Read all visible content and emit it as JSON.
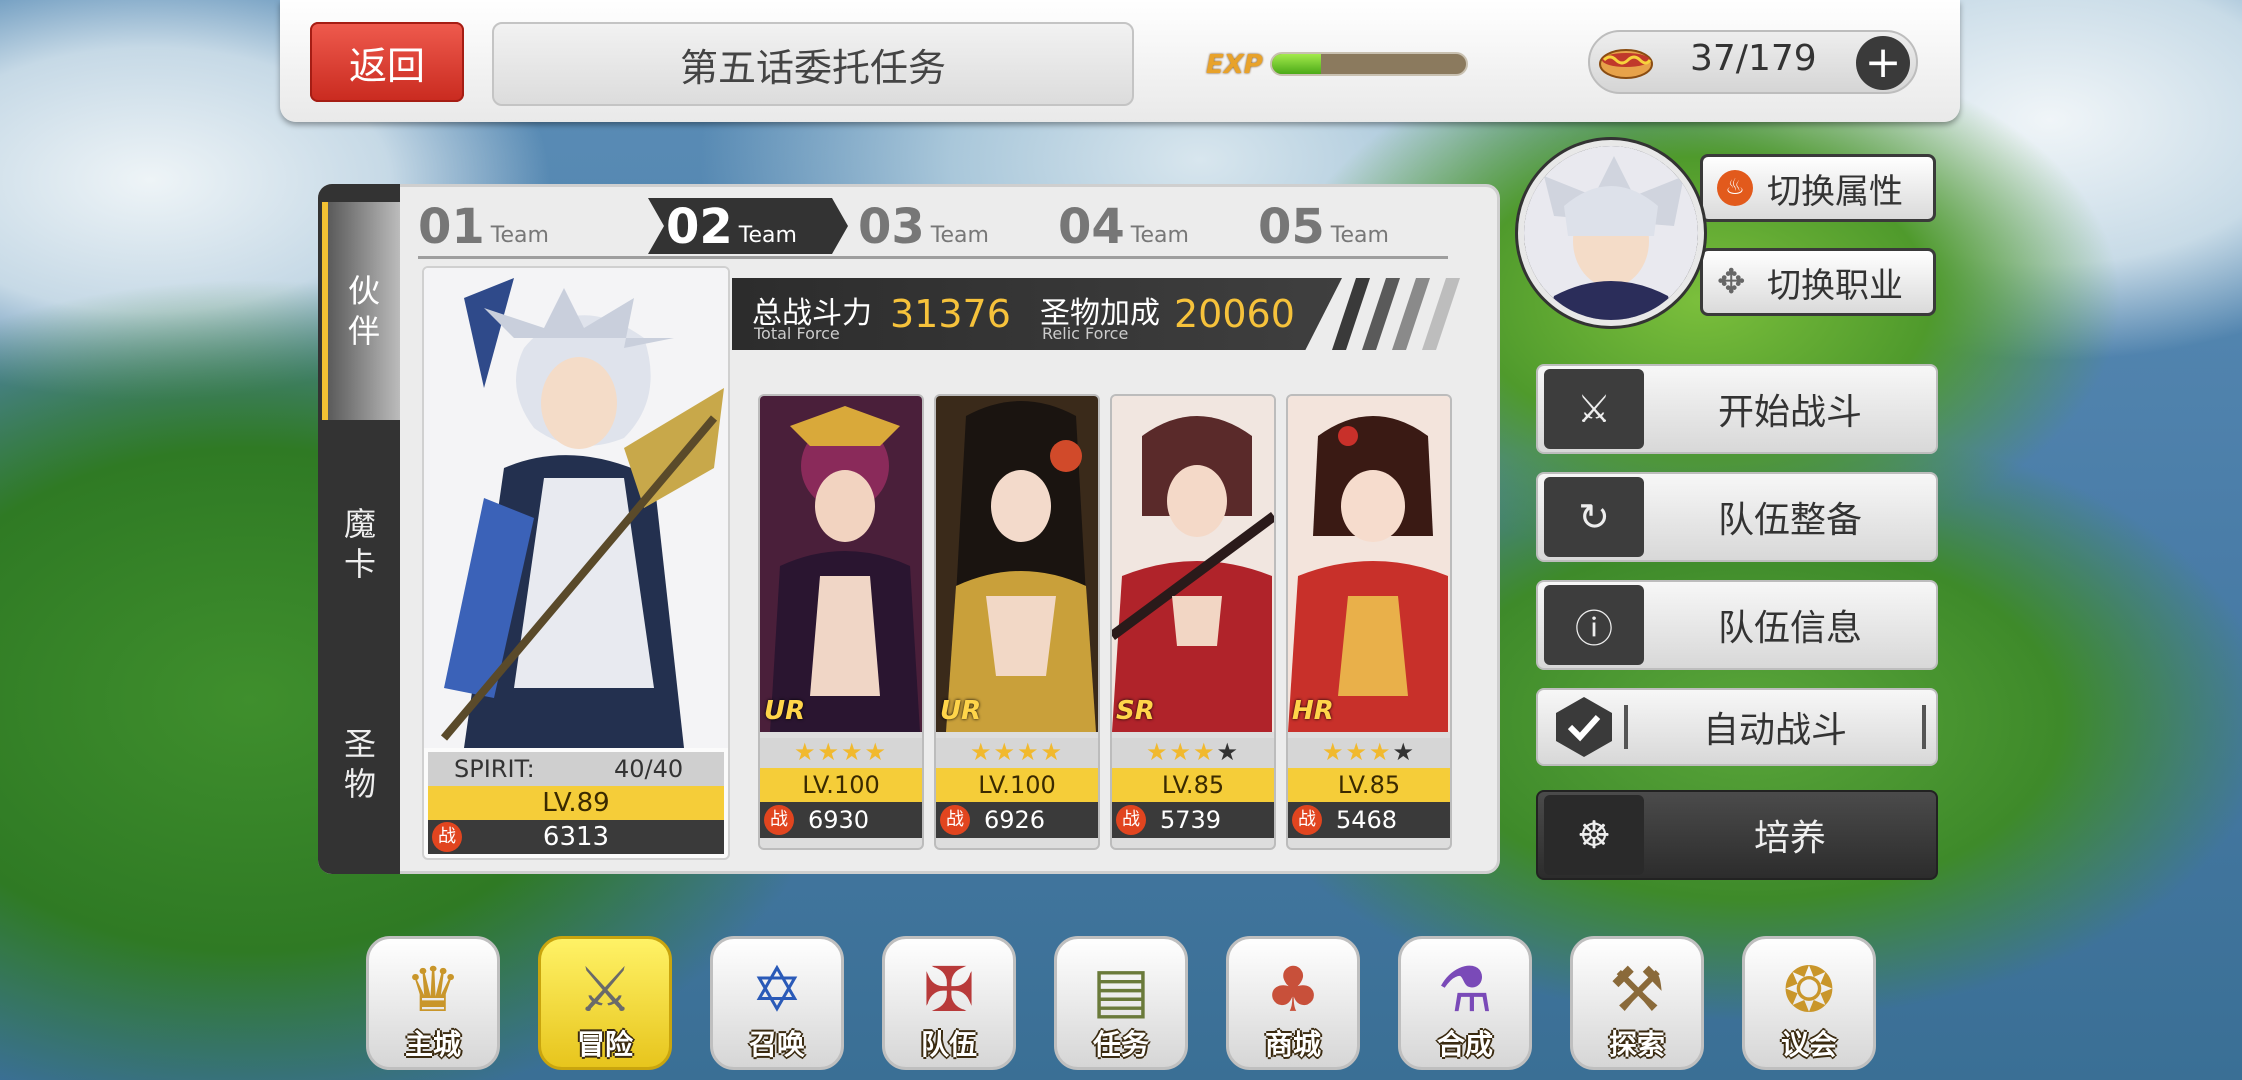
{
  "header": {
    "back_label": "返回",
    "title": "第五话委托任务",
    "exp_label": "EXP",
    "exp_fraction": 0.25,
    "stamina": "37/179",
    "plus_label": "+"
  },
  "side_tabs": [
    {
      "label": "伙\n伴",
      "active": true
    },
    {
      "label": "魔\n卡",
      "active": false
    },
    {
      "label": "圣\n物",
      "active": false
    }
  ],
  "teams": [
    {
      "num": "01",
      "label": "Team"
    },
    {
      "num": "02",
      "label": "Team"
    },
    {
      "num": "03",
      "label": "Team"
    },
    {
      "num": "04",
      "label": "Team"
    },
    {
      "num": "05",
      "label": "Team"
    }
  ],
  "force": {
    "total_label": "总战斗力",
    "total_sub": "Total Force",
    "total_value": "31376",
    "relic_label": "圣物加成",
    "relic_sub": "Relic Force",
    "relic_value": "20060"
  },
  "leader": {
    "spirit_label": "SPIRIT:",
    "spirit_value": "40/40",
    "level": "LV.89",
    "power_badge": "战",
    "power": "6313"
  },
  "members": [
    {
      "rarity": "UR",
      "stars": "★★★★",
      "level": "LV.100",
      "badge": "战",
      "power": "6930",
      "color": "#7a2a4a"
    },
    {
      "rarity": "UR",
      "stars": "★★★★",
      "level": "LV.100",
      "badge": "战",
      "power": "6926",
      "color": "#8a6a2a"
    },
    {
      "rarity": "SR",
      "stars": "★★★★",
      "level": "LV.85",
      "badge": "战",
      "power": "5739",
      "color": "#9a2a2a"
    },
    {
      "rarity": "HR",
      "stars": "★★★★",
      "level": "LV.85",
      "badge": "战",
      "power": "5468",
      "color": "#a8342a"
    }
  ],
  "right": {
    "switch_attr": "切换属性",
    "switch_job": "切换职业",
    "start_battle": "开始战斗",
    "team_prep": "队伍整备",
    "team_info": "队伍信息",
    "auto_battle": "自动战斗",
    "train": "培养"
  },
  "nav": [
    {
      "label": "主城",
      "icon": "castle-crown-icon",
      "glyph": "♛",
      "active": false
    },
    {
      "label": "冒险",
      "icon": "crossed-swords-icon",
      "glyph": "⚔",
      "active": true
    },
    {
      "label": "召唤",
      "icon": "summon-book-icon",
      "glyph": "✡",
      "active": false
    },
    {
      "label": "队伍",
      "icon": "winged-emblem-icon",
      "glyph": "✠",
      "active": false
    },
    {
      "label": "任务",
      "icon": "quest-book-icon",
      "glyph": "▤",
      "active": false
    },
    {
      "label": "商城",
      "icon": "shop-tree-icon",
      "glyph": "♣",
      "active": false
    },
    {
      "label": "合成",
      "icon": "potion-flask-icon",
      "glyph": "⚗",
      "active": false
    },
    {
      "label": "探索",
      "icon": "shovel-pick-icon",
      "glyph": "⚒",
      "active": false
    },
    {
      "label": "议会",
      "icon": "council-crest-icon",
      "glyph": "❂",
      "active": false
    }
  ]
}
